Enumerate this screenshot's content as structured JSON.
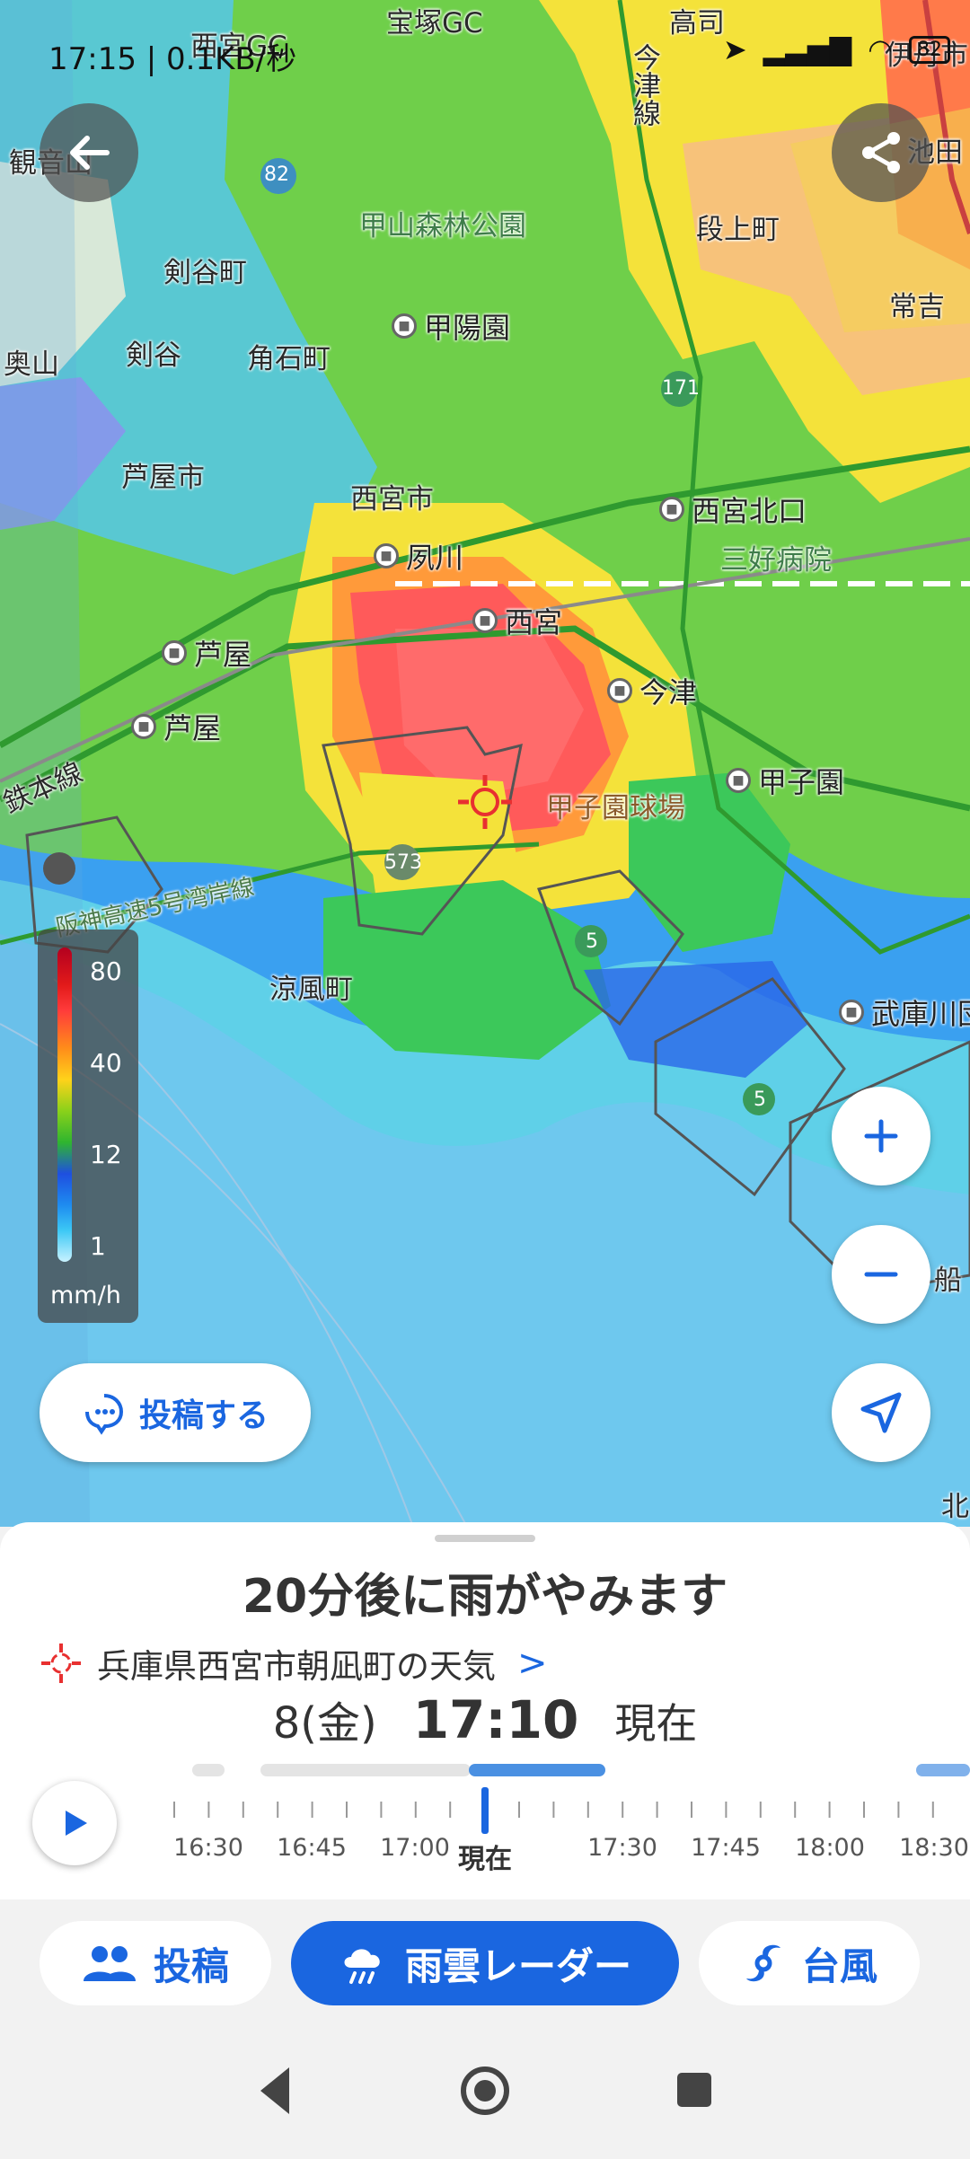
{
  "status_bar": {
    "time": "17:15 | 0.1KB/秒",
    "battery": "82"
  },
  "map": {
    "labels": [
      {
        "text": "西宮GC"
      },
      {
        "text": "宝塚GC"
      },
      {
        "text": "高司"
      },
      {
        "text": "伊丹市"
      },
      {
        "text": "今津線"
      },
      {
        "text": "池田"
      },
      {
        "text": "観音山"
      },
      {
        "text": "甲山森林公園"
      },
      {
        "text": "段上町"
      },
      {
        "text": "常吉"
      },
      {
        "text": "剣谷町"
      },
      {
        "text": "剣谷"
      },
      {
        "text": "角石町"
      },
      {
        "text": "奥山"
      },
      {
        "text": "芦屋市"
      },
      {
        "text": "西宮市"
      },
      {
        "text": "三好病院"
      },
      {
        "text": "甲子園球場"
      },
      {
        "text": "涼風町"
      },
      {
        "text": "鉄本線"
      },
      {
        "text": "阪神高速5号湾岸線"
      },
      {
        "text": "北"
      },
      {
        "text": "船"
      }
    ],
    "stations": [
      "甲陽園",
      "西宮北口",
      "夙川",
      "西宮",
      "芦屋",
      "芦屋",
      "今津",
      "甲子園",
      "武庫川団"
    ],
    "route_shields": [
      "82",
      "171",
      "573",
      "5",
      "5"
    ]
  },
  "legend": {
    "ticks": [
      "80",
      "40",
      "12",
      "1"
    ],
    "unit": "mm/h"
  },
  "post_button": "投稿する",
  "sheet": {
    "headline": "20分後に雨がやみます",
    "location": "兵庫県西宮市朝凪町の天気",
    "date": "8(金)",
    "time": "17:10",
    "now_label": "現在",
    "timeline_labels": [
      "16:30",
      "16:45",
      "17:00",
      "現在",
      "17:30",
      "17:45",
      "18:00",
      "18:30"
    ]
  },
  "nav": {
    "post": "投稿",
    "radar": "雨雲レーダー",
    "typhoon": "台風"
  },
  "colors": {
    "accent": "#1a66e0"
  }
}
